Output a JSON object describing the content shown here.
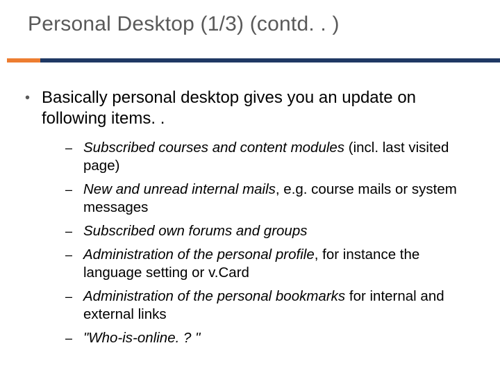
{
  "title": "Personal Desktop (1/3) (contd. . )",
  "lead": "Basically personal desktop gives you an update on following items. .",
  "bullet": "•",
  "dash": "–",
  "items": [
    {
      "em": "Subscribed courses and content modules",
      "rest": " (incl. last visited page)"
    },
    {
      "em": "New and unread internal mails",
      "rest": ", e.g. course mails or system messages"
    },
    {
      "em": "Subscribed own forums and groups",
      "rest": ""
    },
    {
      "em": "Administration of the personal profile",
      "rest": ", for instance the language setting or v.Card"
    },
    {
      "em": "Administration of the personal bookmarks",
      "rest": " for internal and external links"
    },
    {
      "em": "\"Who-is-online. ? \"",
      "rest": ""
    }
  ]
}
